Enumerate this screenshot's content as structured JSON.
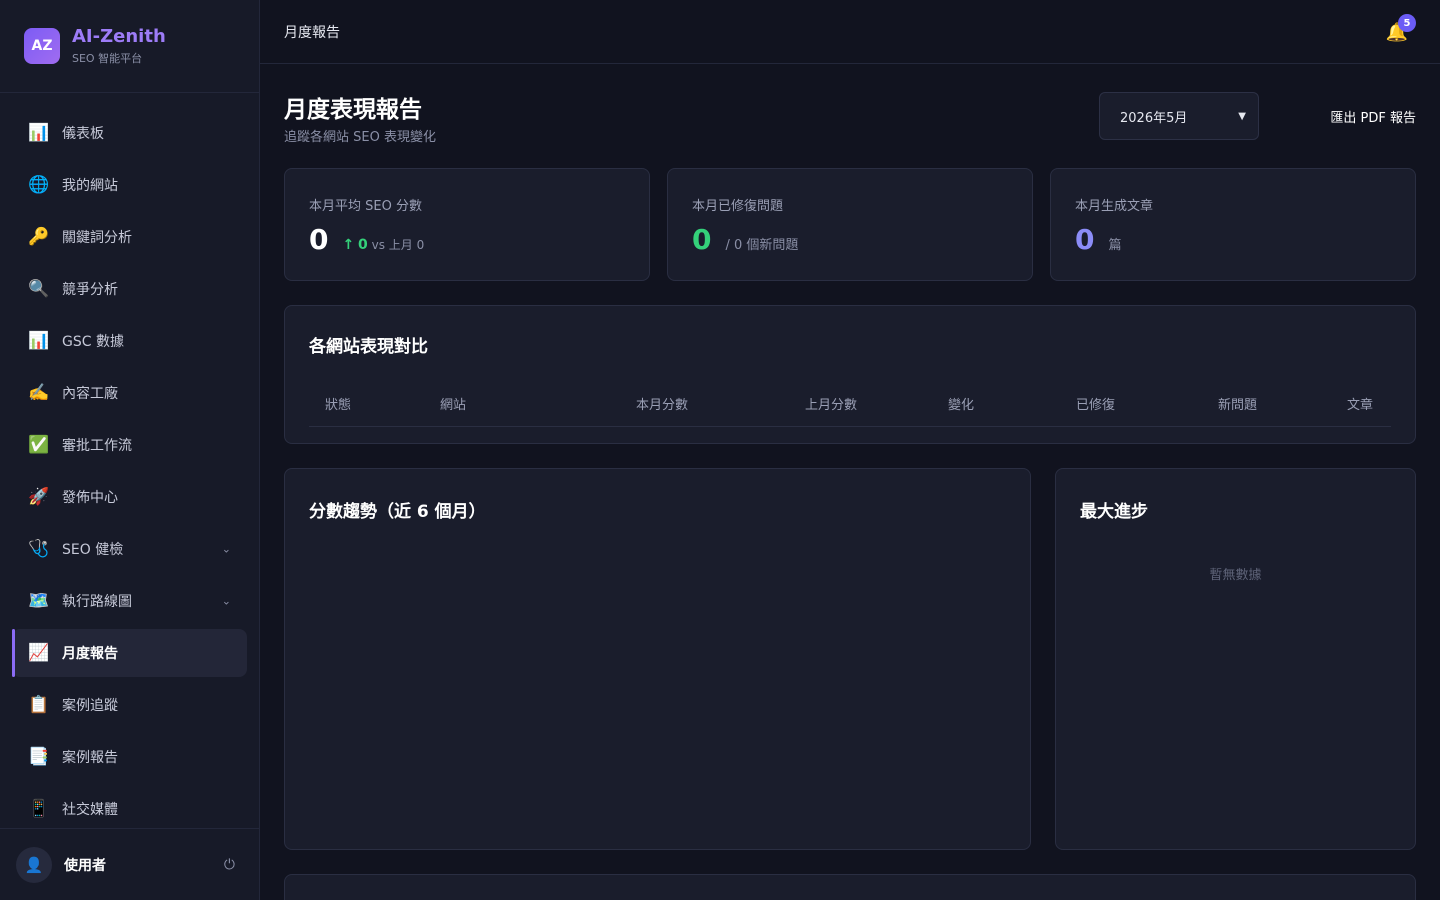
{
  "brand": {
    "logo": "AZ",
    "name": "AI-Zenith",
    "subtitle": "SEO 智能平台"
  },
  "sidebar": {
    "items": [
      {
        "icon": "📊",
        "icon_name": "bar-chart-icon",
        "label": "儀表板"
      },
      {
        "icon": "🌐",
        "icon_name": "globe-icon",
        "label": "我的網站"
      },
      {
        "icon": "🔑",
        "icon_name": "key-icon",
        "label": "關鍵詞分析"
      },
      {
        "icon": "🔍",
        "icon_name": "magnifier-icon",
        "label": "競爭分析"
      },
      {
        "icon": "📊",
        "icon_name": "bar-chart-icon",
        "label": "GSC 數據"
      },
      {
        "icon": "✍️",
        "icon_name": "writing-hand-icon",
        "label": "內容工廠"
      },
      {
        "icon": "✅",
        "icon_name": "check-mark-icon",
        "label": "審批工作流"
      },
      {
        "icon": "🚀",
        "icon_name": "rocket-icon",
        "label": "發佈中心"
      },
      {
        "icon": "🩺",
        "icon_name": "stethoscope-icon",
        "label": "SEO 健檢",
        "expandable": true
      },
      {
        "icon": "🗺️",
        "icon_name": "map-icon",
        "label": "執行路線圖",
        "expandable": true
      },
      {
        "icon": "📈",
        "icon_name": "trend-chart-icon",
        "label": "月度報告",
        "active": true
      },
      {
        "icon": "📋",
        "icon_name": "clipboard-icon",
        "label": "案例追蹤"
      },
      {
        "icon": "📑",
        "icon_name": "bookmark-tabs-icon",
        "label": "案例報告"
      },
      {
        "icon": "📱",
        "icon_name": "mobile-phone-icon",
        "label": "社交媒體"
      }
    ]
  },
  "user": {
    "avatar": "👤",
    "name": "使用者",
    "logout_icon": "⏻"
  },
  "topbar": {
    "breadcrumb": "月度報告",
    "bell_icon": "🔔",
    "notification_count": "5"
  },
  "page": {
    "title": "月度表現報告",
    "subtitle": "追蹤各網站 SEO 表現變化",
    "month_selected": "2026年5月",
    "export_label": "匯出 PDF 報告"
  },
  "stats": {
    "avg_score": {
      "label": "本月平均 SEO 分數",
      "value": "0",
      "arrow": "↑",
      "delta": "0",
      "compare": "vs 上月 0"
    },
    "fixed": {
      "label": "本月已修復問題",
      "value": "0",
      "extra": "/ 0 個新問題"
    },
    "articles": {
      "label": "本月生成文章",
      "value": "0",
      "unit": "篇"
    }
  },
  "comparison": {
    "title": "各網站表現對比",
    "columns": [
      "狀態",
      "網站",
      "本月分數",
      "上月分數",
      "變化",
      "已修復",
      "新問題",
      "文章"
    ]
  },
  "trend": {
    "title": "分數趨勢（近 6 個月）"
  },
  "progress": {
    "title": "最大進步",
    "empty": "暫無數據"
  },
  "colors": {
    "accent": "#8b6cf5",
    "positive": "#34d17a",
    "articles_value": "#8b8cf7",
    "background": "#11131f"
  }
}
